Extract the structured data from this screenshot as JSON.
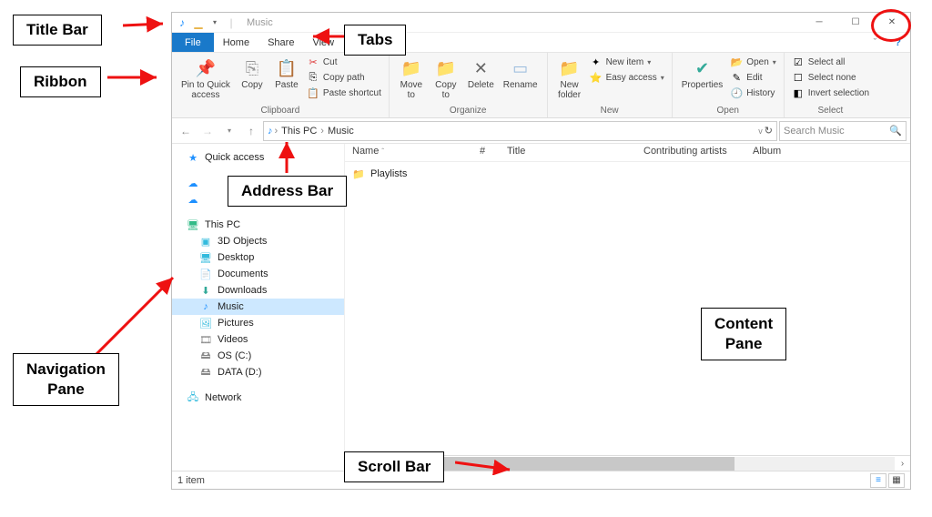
{
  "annotations": {
    "titlebar": "Title Bar",
    "tabs": "Tabs",
    "ribbon": "Ribbon",
    "addressbar": "Address Bar",
    "navpane": "Navigation\nPane",
    "contentpane": "Content\nPane",
    "scrollbar": "Scroll Bar"
  },
  "titlebar": {
    "app_title": "Music"
  },
  "tabs": {
    "file": "File",
    "home": "Home",
    "share": "Share",
    "view": "View"
  },
  "ribbon": {
    "pin": "Pin to Quick\naccess",
    "copy": "Copy",
    "paste": "Paste",
    "cut": "Cut",
    "copypath": "Copy path",
    "pasteshortcut": "Paste shortcut",
    "clipboard_group": "Clipboard",
    "moveto": "Move\nto",
    "copyto": "Copy\nto",
    "delete": "Delete",
    "rename": "Rename",
    "organize_group": "Organize",
    "newfolder": "New\nfolder",
    "newitem": "New item",
    "easyaccess": "Easy access",
    "new_group": "New",
    "properties": "Properties",
    "open": "Open",
    "edit": "Edit",
    "history": "History",
    "open_group": "Open",
    "selectall": "Select all",
    "selectnone": "Select none",
    "invert": "Invert selection",
    "select_group": "Select"
  },
  "addressbar": {
    "crumb1": "This PC",
    "crumb2": "Music",
    "search_placeholder": "Search Music"
  },
  "navpane": {
    "quickaccess": "Quick access",
    "onedrive": "",
    "thispc": "This PC",
    "objects3d": "3D Objects",
    "desktop": "Desktop",
    "documents": "Documents",
    "downloads": "Downloads",
    "music": "Music",
    "pictures": "Pictures",
    "videos": "Videos",
    "osc": "OS (C:)",
    "datad": "DATA (D:)",
    "network": "Network"
  },
  "columns": {
    "name": "Name",
    "num": "#",
    "title": "Title",
    "artists": "Contributing artists",
    "album": "Album"
  },
  "items": {
    "playlists": "Playlists"
  },
  "status": {
    "count": "1 item"
  }
}
